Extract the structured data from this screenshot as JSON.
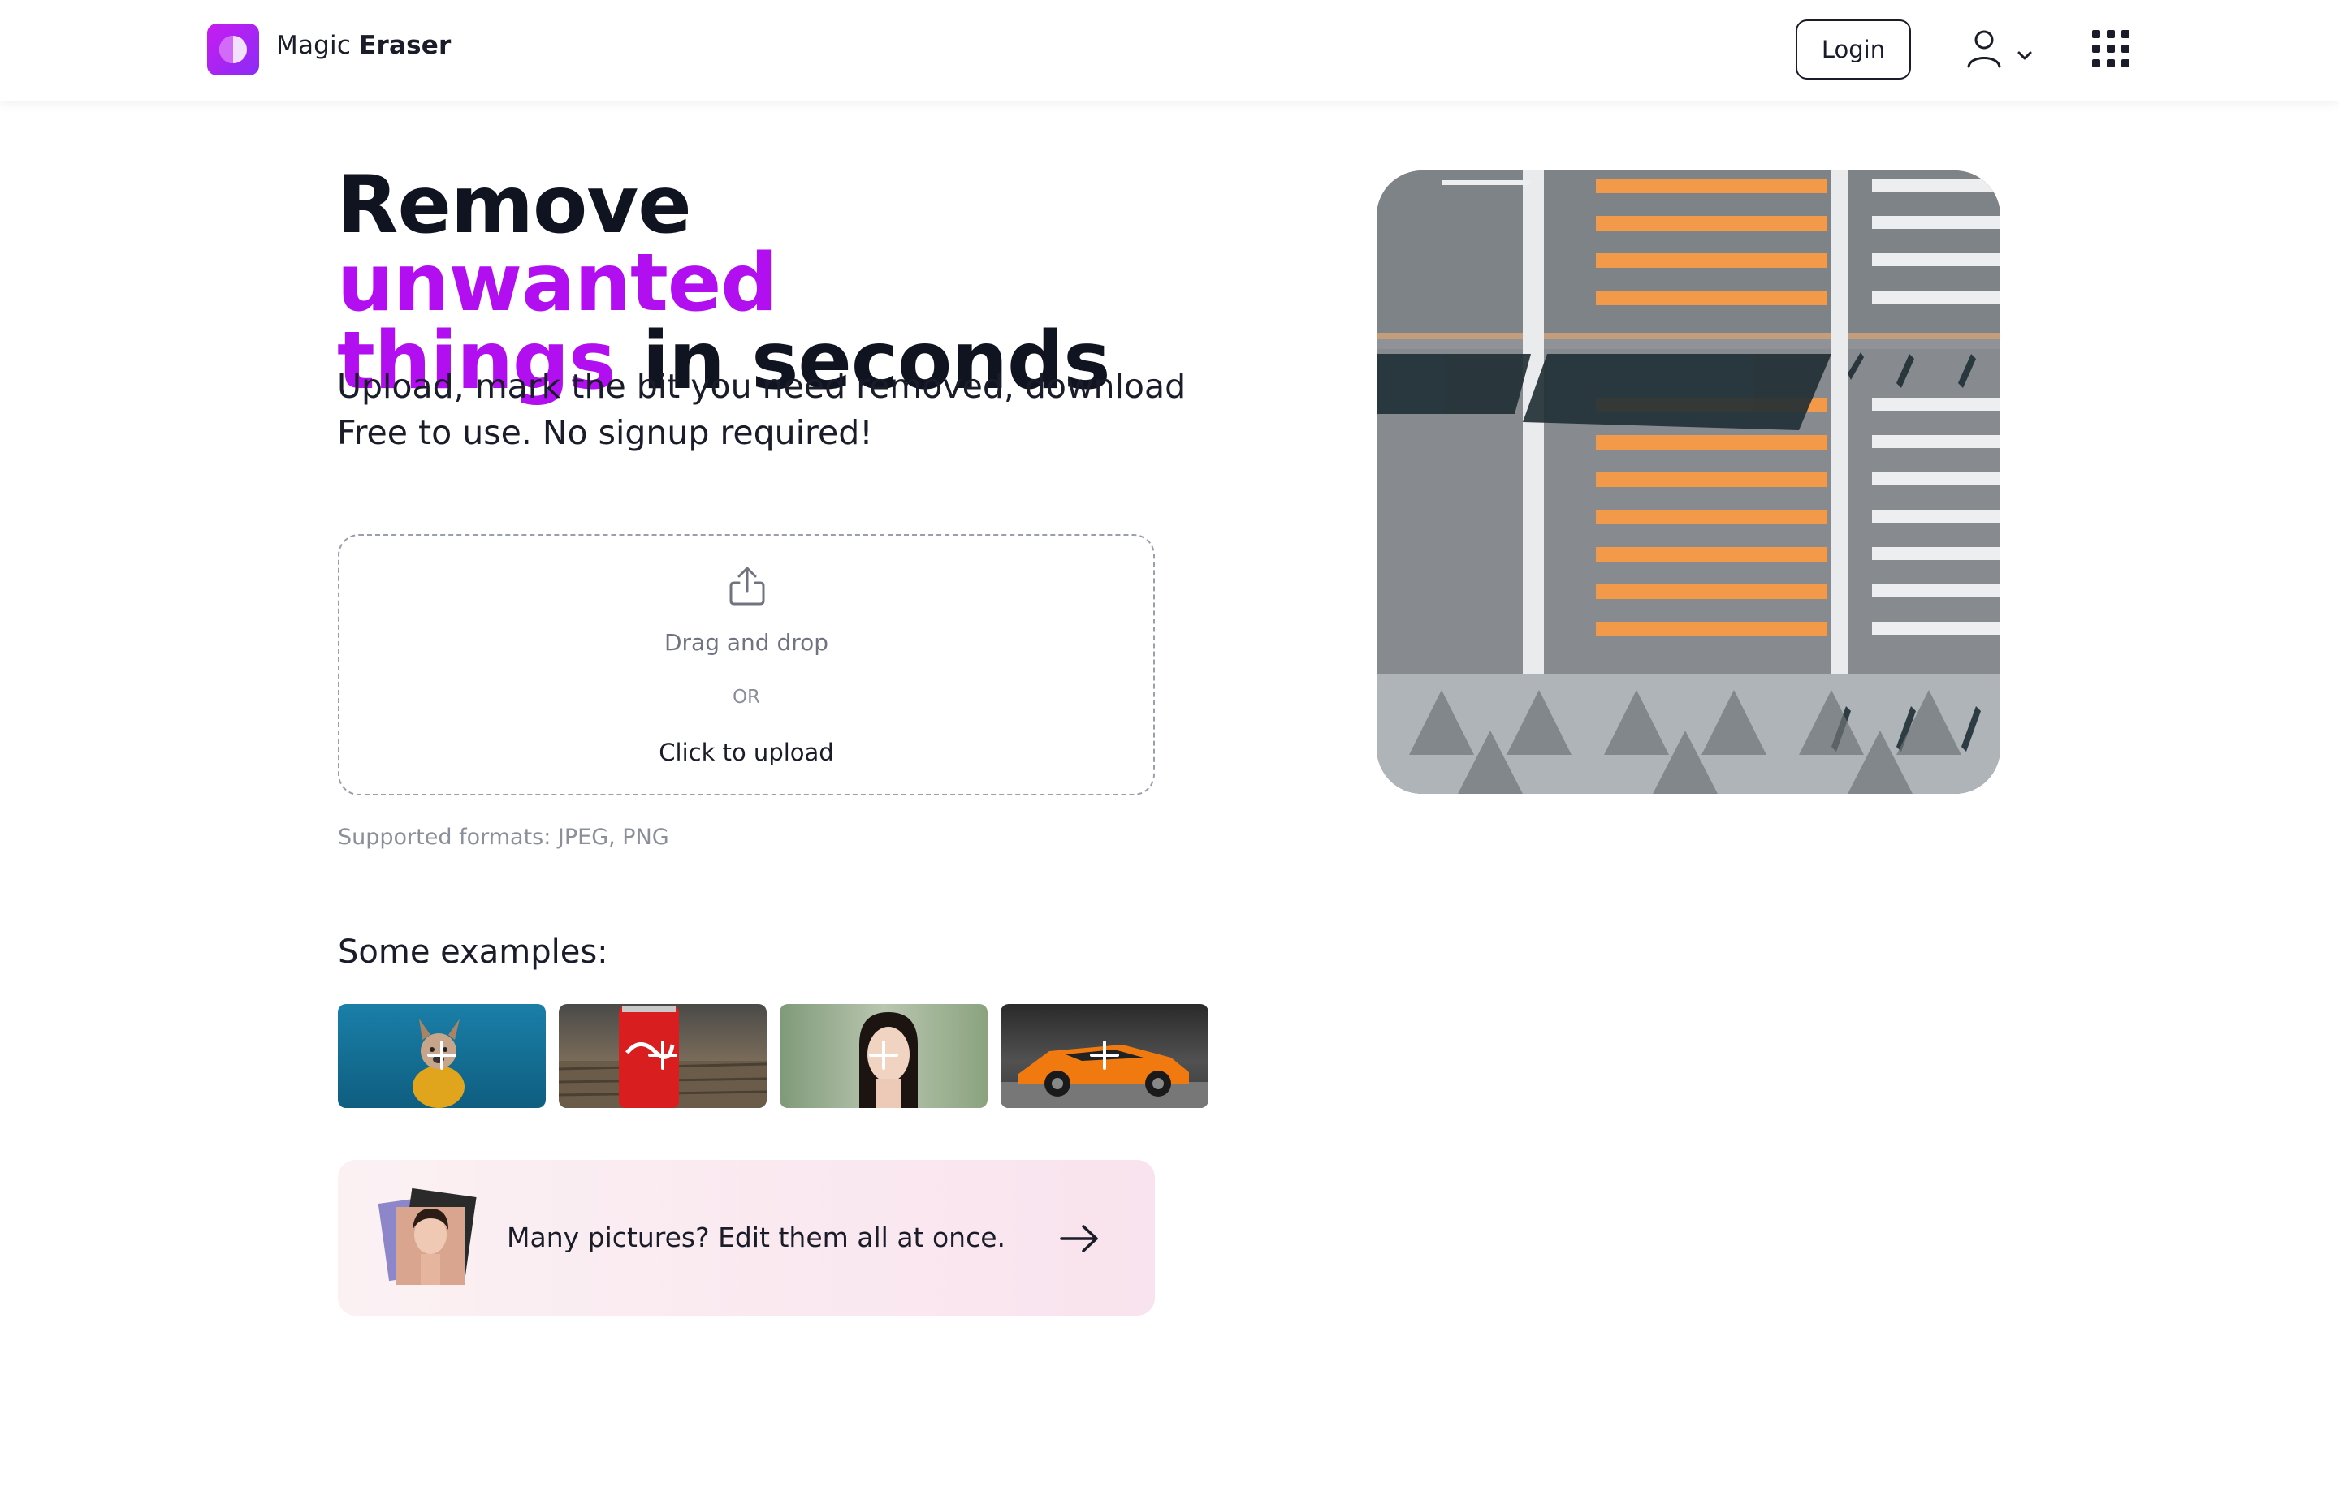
{
  "header": {
    "logo_text_regular": "Magic",
    "logo_text_bold": "Eraser",
    "login_label": "Login"
  },
  "hero": {
    "title_part1": "Remove ",
    "title_accent1": "unwanted",
    "title_accent2": "things",
    "title_part2": " in seconds",
    "subtitle_line1": "Upload, mark the bit you need removed, download",
    "subtitle_line2": "Free to use. No signup required!"
  },
  "upload": {
    "drag_text": "Drag and drop",
    "or_text": "OR",
    "click_text": "Click to upload",
    "formats_text": "Supported formats: JPEG, PNG"
  },
  "examples": {
    "title": "Some examples:",
    "items": [
      {
        "name": "dog-example"
      },
      {
        "name": "cola-can-example"
      },
      {
        "name": "woman-portrait-example"
      },
      {
        "name": "sports-car-example"
      }
    ]
  },
  "batch": {
    "text": "Many pictures? Edit them all at once."
  },
  "colors": {
    "accent": "#b10ff0",
    "text": "#0f1420",
    "logo_gradient_start": "#c81cf0",
    "logo_gradient_end": "#8b2cf5"
  },
  "icons": [
    "user-icon",
    "chevron-down-icon",
    "apps-grid-icon",
    "upload-icon",
    "plus-icon",
    "arrow-right-icon"
  ]
}
